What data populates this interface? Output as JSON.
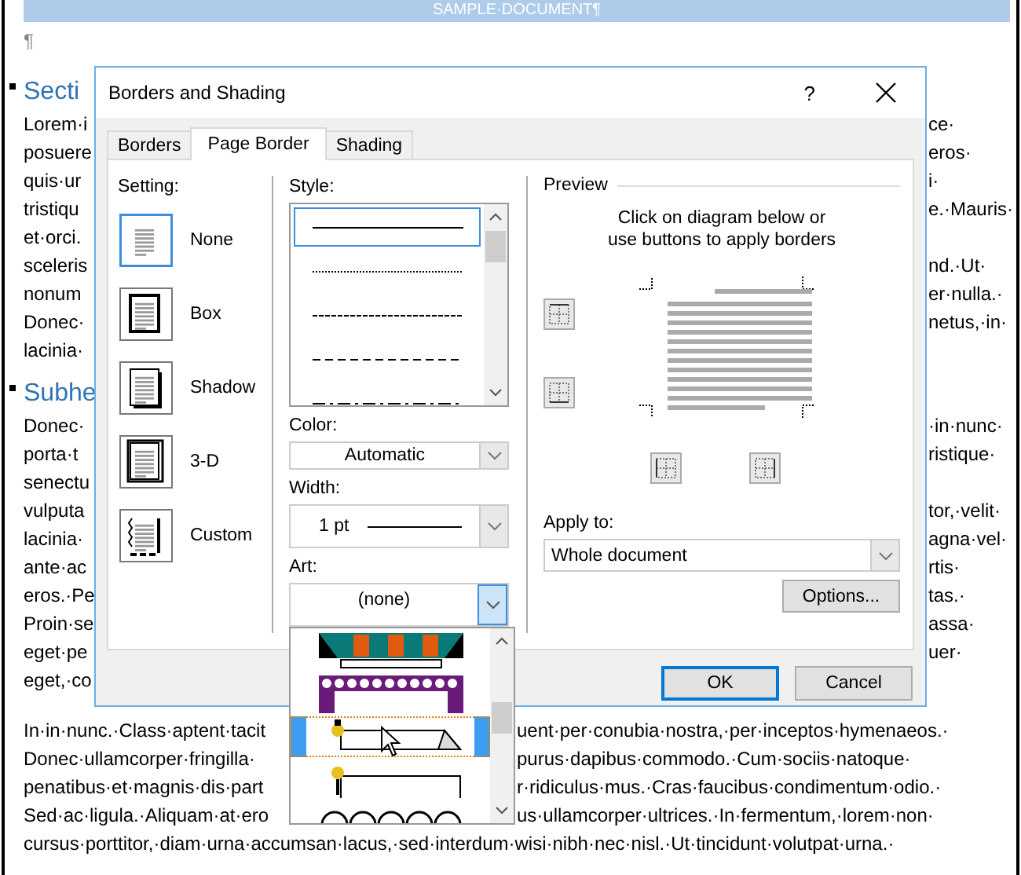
{
  "document": {
    "header": "SAMPLE·DOCUMENT¶",
    "pilcrow": "¶",
    "sections": [
      {
        "heading": "Secti",
        "lines": [
          {
            "left": "Lorem·i",
            "right": "ce·"
          },
          {
            "left": "posuere",
            "right": "eros·"
          },
          {
            "left": "quis·ur",
            "right": "i·"
          },
          {
            "left": "tristiqu",
            "right": "e.·Mauris·"
          },
          {
            "left": "et·orci."
          },
          {
            "left": "sceleris",
            "right": "nd.·Ut·"
          },
          {
            "left": "nonum",
            "right": "er·nulla.·"
          },
          {
            "left": "Donec·",
            "right": "netus,·in·"
          },
          {
            "left": "lacinia·"
          }
        ]
      },
      {
        "heading": "Subhe",
        "lines": [
          {
            "left": "Donec·",
            "right": "·in·nunc·"
          },
          {
            "left": "porta·t",
            "right": "ristique·"
          },
          {
            "left": "senectu"
          },
          {
            "left": "vulputa",
            "right": "tor,·velit·"
          },
          {
            "left": "lacinia·",
            "right": "agna·vel·"
          },
          {
            "left": "ante·ac",
            "right": "rtis·"
          },
          {
            "left": "eros.·Pe",
            "right": "tas.·"
          },
          {
            "left": "Proin·se",
            "right": "assa·"
          },
          {
            "left": "eget·pe",
            "right": "uer·"
          },
          {
            "left": "eget,·co"
          }
        ]
      }
    ],
    "bottom_lines": [
      {
        "left": "In·in·nunc.·Class·aptent·tacit",
        "right": "uent·per·conubia·nostra,·per·inceptos·hymenaeos.·"
      },
      {
        "left": "Donec·ullamcorper·fringilla·",
        "right": "purus·dapibus·commodo.·Cum·sociis·natoque·"
      },
      {
        "left": "penatibus·et·magnis·dis·part",
        "right": "r·ridiculus·mus.·Cras·faucibus·condimentum·odio.·"
      },
      {
        "left": "Sed·ac·ligula.·Aliquam·at·ero",
        "right": "us·ullamcorper·ultrices.·In·fermentum,·lorem·non·"
      },
      {
        "text": "cursus·porttitor,·diam·urna·accumsan·lacus,·sed·interdum·wisi·nibh·nec·nisl.·Ut·tincidunt·volutpat·urna.·"
      }
    ]
  },
  "dialog": {
    "title": "Borders and Shading",
    "help": "?",
    "tabs": [
      {
        "label": "Borders",
        "selected": false
      },
      {
        "label": "Page Border",
        "selected": true
      },
      {
        "label": "Shading",
        "selected": false
      }
    ],
    "setting": {
      "label": "Setting:",
      "options": [
        {
          "label": "None",
          "kind": "none",
          "selected": true
        },
        {
          "label": "Box",
          "kind": "box",
          "selected": false
        },
        {
          "label": "Shadow",
          "kind": "shadow",
          "selected": false
        },
        {
          "label": "3-D",
          "kind": "threed",
          "selected": false
        },
        {
          "label": "Custom",
          "kind": "custom",
          "selected": false
        }
      ]
    },
    "style": {
      "label": "Style:",
      "options": [
        {
          "kind": "solid",
          "selected": true
        },
        {
          "kind": "dotted",
          "selected": false
        },
        {
          "kind": "fine-dash",
          "selected": false
        },
        {
          "kind": "dash",
          "selected": false
        },
        {
          "kind": "dash-dot",
          "selected": false
        }
      ]
    },
    "color": {
      "label": "Color:",
      "value": "Automatic"
    },
    "width": {
      "label": "Width:",
      "value": "1 pt"
    },
    "art": {
      "label": "Art:",
      "value": "(none)",
      "open": true,
      "options": [
        {
          "kind": "banner",
          "selected": false
        },
        {
          "kind": "spiral",
          "selected": false
        },
        {
          "kind": "pushpin-paper",
          "selected": true
        },
        {
          "kind": "pushpin",
          "selected": false
        },
        {
          "kind": "pumpkin",
          "selected": false
        }
      ]
    },
    "preview": {
      "label": "Preview",
      "hint": "Click on diagram below or\nuse buttons to apply borders",
      "border_buttons": [
        {
          "kind": "top"
        },
        {
          "kind": "bottom"
        },
        {
          "kind": "left"
        },
        {
          "kind": "right"
        }
      ]
    },
    "apply_to": {
      "label": "Apply to:",
      "value": "Whole document"
    },
    "buttons": [
      {
        "label": "Options...",
        "kind": "options"
      },
      {
        "label": "OK",
        "kind": "ok"
      },
      {
        "label": "Cancel",
        "kind": "cancel"
      }
    ]
  }
}
